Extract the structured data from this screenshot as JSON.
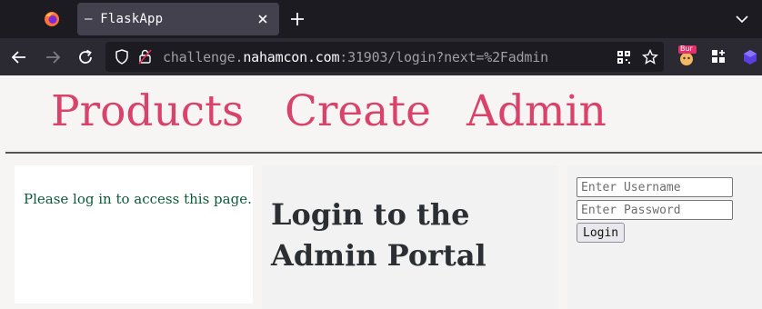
{
  "browser": {
    "tab_title": "– FlaskApp",
    "url_prefix": "challenge.",
    "url_host": "nahamcon.com",
    "url_suffix": ":31903/login?next=%2Fadmin",
    "extension_badge": "Bur"
  },
  "nav": {
    "items": [
      {
        "label": "Products"
      },
      {
        "label": "Create"
      },
      {
        "label": "Admin"
      }
    ]
  },
  "flash": {
    "message": "Please log in to access this page."
  },
  "main": {
    "title": "Login to the Admin Portal"
  },
  "login": {
    "username_placeholder": "Enter Username",
    "password_placeholder": "Enter Password",
    "button_label": "Login"
  },
  "colors": {
    "nav_link": "#d9436a",
    "flash_text": "#0b5a3a",
    "title_text": "#2b2f33"
  }
}
